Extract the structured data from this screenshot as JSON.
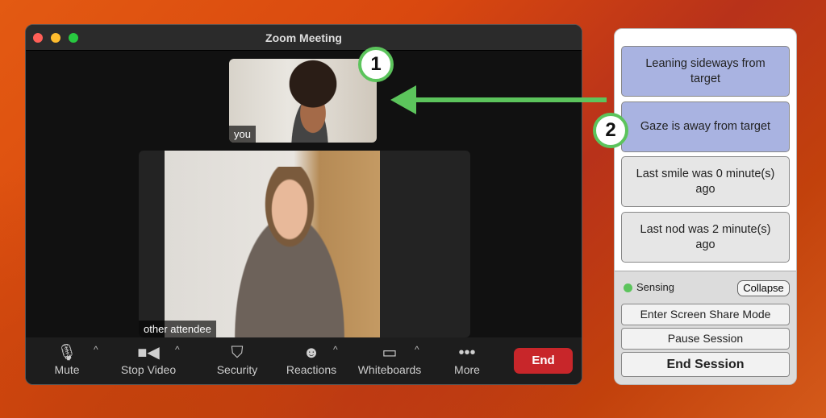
{
  "window": {
    "title": "Zoom Meeting"
  },
  "video": {
    "self_label": "you",
    "other_label": "other attendee"
  },
  "toolbar": {
    "items": [
      {
        "label": "Mute",
        "icon": "microphone-icon"
      },
      {
        "label": "Stop Video",
        "icon": "video-camera-icon"
      },
      {
        "label": "Security",
        "icon": "shield-icon"
      },
      {
        "label": "Reactions",
        "icon": "emoji-add-icon"
      },
      {
        "label": "Whiteboards",
        "icon": "whiteboard-icon"
      },
      {
        "label": "More",
        "icon": "more-dots-icon"
      }
    ],
    "end_label": "End",
    "end_color": "#c8262a"
  },
  "panel": {
    "cards": [
      "Leaning sideways from target",
      "Gaze is away from target",
      "Last smile was 0 minute(s) ago",
      "Last nod was 2 minute(s) ago"
    ],
    "status": "Sensing",
    "status_color": "#5cc45c",
    "collapse": "Collapse",
    "screen_share": "Enter Screen Share Mode",
    "pause": "Pause Session",
    "end_session": "End Session"
  },
  "annotations": {
    "badge1": "1",
    "badge2": "2",
    "color": "#5cc45c"
  }
}
